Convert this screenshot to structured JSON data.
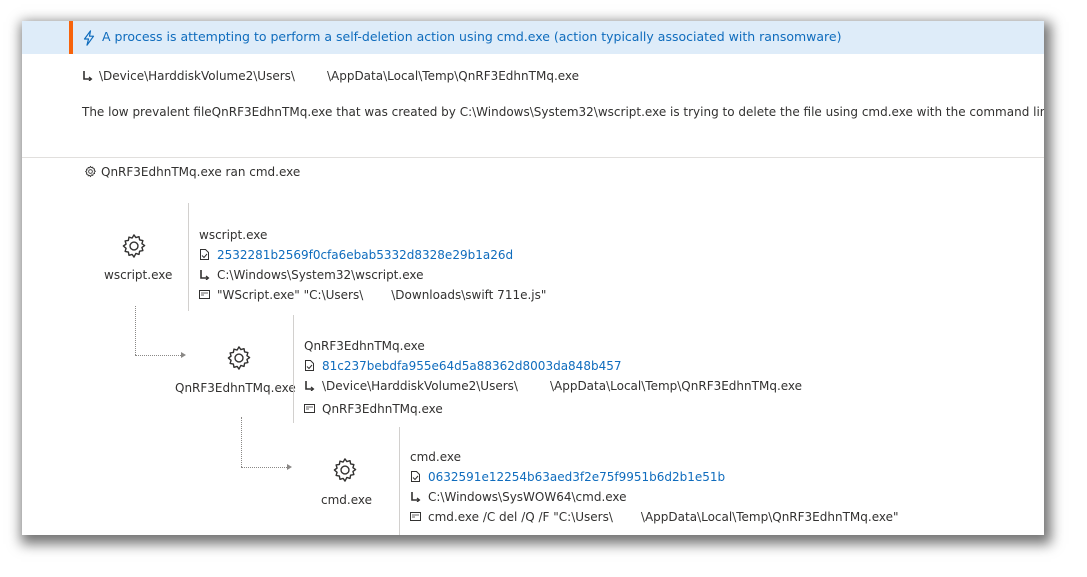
{
  "alert": {
    "title": "A process is attempting to perform a self-deletion action using cmd.exe (action typically associated with ransomware)",
    "accent_color": "#f7630c",
    "icon": "lightning-icon"
  },
  "summary": {
    "path_pre": "\\Device\\HarddiskVolume2\\Users\\",
    "path_post": "\\AppData\\Local\\Temp\\QnRF3EdhnTMq.exe",
    "description": "The low prevalent fileQnRF3EdhnTMq.exe that was created by  C:\\Windows\\System32\\wscript.exe  is trying to delete the file  using cmd.exe with the command line: cmd /D /"
  },
  "tree": {
    "header": "QnRF3EdhnTMq.exe ran cmd.exe",
    "nodes": [
      {
        "label": "wscript.exe",
        "name": "wscript.exe",
        "hash": "2532281b2569f0cfa6ebab5332d8328e29b1a26d",
        "path": "C:\\Windows\\System32\\wscript.exe",
        "cmd_pre": "\"WScript.exe\" \"C:\\Users\\",
        "cmd_post": "\\Downloads\\swift 711e.js\""
      },
      {
        "label": "QnRF3EdhnTMq.exe",
        "name": "QnRF3EdhnTMq.exe",
        "hash": "81c237bebdfa955e64d5a88362d8003da848b457",
        "path_pre": "\\Device\\HarddiskVolume2\\Users\\",
        "path_post": "\\AppData\\Local\\Temp\\QnRF3EdhnTMq.exe",
        "cmd": "QnRF3EdhnTMq.exe"
      },
      {
        "label": "cmd.exe",
        "name": "cmd.exe",
        "hash": "0632591e12254b63aed3f2e75f9951b6d2b1e51b",
        "path": "C:\\Windows\\SysWOW64\\cmd.exe",
        "cmd_pre": "cmd.exe /C del /Q /F \"C:\\Users\\",
        "cmd_post": "\\AppData\\Local\\Temp\\QnRF3EdhnTMq.exe\""
      }
    ]
  },
  "colors": {
    "link": "#0f6cbd",
    "alert_bg": "#deecf9",
    "text": "#323130"
  }
}
